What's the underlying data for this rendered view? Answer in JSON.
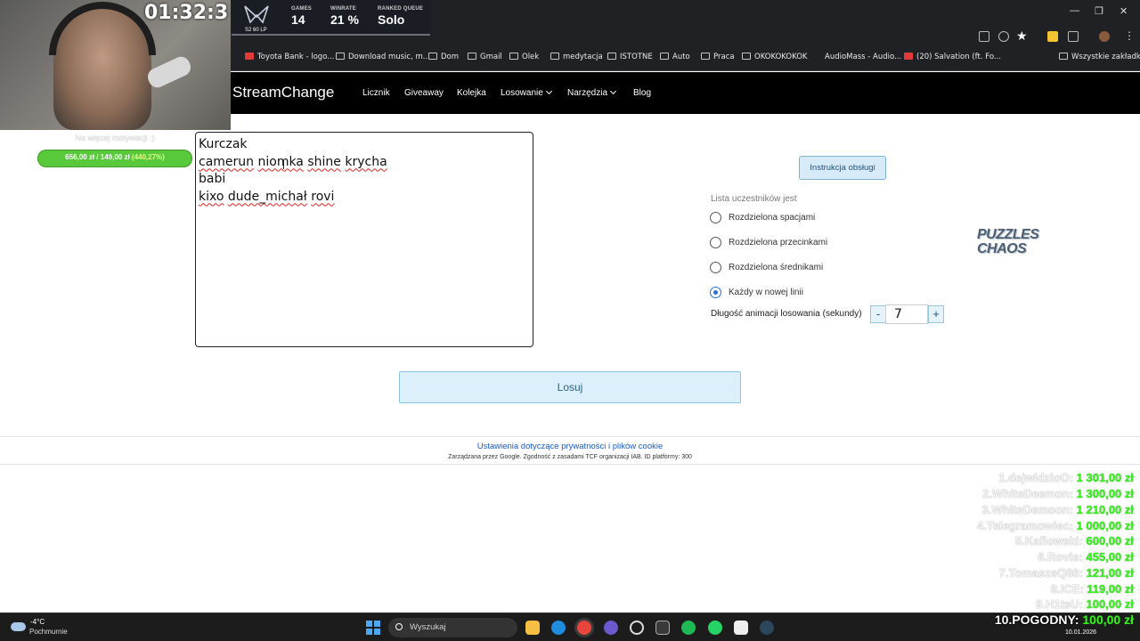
{
  "overlay": {
    "timer": "01:32:3",
    "stats": [
      {
        "label": "GAMES",
        "value": "14"
      },
      {
        "label": "WINRATE",
        "value": "21 %"
      },
      {
        "label": "RANKED QUEUE",
        "value": "Solo"
      }
    ],
    "lp": "S2 60 LP",
    "goal_label": "Na więcej motywacji :)",
    "goal_amount": "656,00 zł / 149,00 zł",
    "goal_pct": "(440,27%)"
  },
  "bookmarks": [
    {
      "label": "Toyota Bank - logo..."
    },
    {
      "label": "Download music, m..."
    },
    {
      "label": "Dom"
    },
    {
      "label": "Gmail"
    },
    {
      "label": "Olek"
    },
    {
      "label": "medytacja"
    },
    {
      "label": "ISTOTNE"
    },
    {
      "label": "Auto"
    },
    {
      "label": "Praca"
    },
    {
      "label": "OKOKOKOKOK"
    },
    {
      "label": "AudioMass - Audio..."
    },
    {
      "label": "(20) Salvation (ft. Fo..."
    },
    {
      "label": "Wszystkie zakładki"
    }
  ],
  "site": {
    "logo": "StreamChange",
    "nav": [
      {
        "label": "Licznik"
      },
      {
        "label": "Giveaway"
      },
      {
        "label": "Kolejka"
      },
      {
        "label": "Losowanie"
      },
      {
        "label": "Narzędzia"
      },
      {
        "label": "Blog"
      }
    ]
  },
  "participants": [
    "Kurczak",
    "camerun",
    "niomka",
    "shine",
    "krycha",
    "babi",
    "kixo",
    "dude_michał",
    "rovi"
  ],
  "options": {
    "instruction_button": "Instrukcja obsługi",
    "list_label": "Lista uczestników jest",
    "radios": [
      {
        "label": "Rozdzielona spacjami",
        "checked": false
      },
      {
        "label": "Rozdzielona przecinkami",
        "checked": false
      },
      {
        "label": "Rozdzielona średnikami",
        "checked": false
      },
      {
        "label": "Każdy w nowej linii",
        "checked": true
      }
    ],
    "duration_label": "Długość animacji losowania (sekundy)",
    "duration_minus": "-",
    "duration_value": "7",
    "duration_plus": "+",
    "partner_logo": "PUZZLES CHAOS"
  },
  "draw_button": "Losuj",
  "footer": {
    "privacy_link": "Ustawienia dotyczące prywatności i plików cookie",
    "privacy_note": "Zarządzana przez Google. Zgodność z zasadami TCF organizacji IAB. ID platformy: 300"
  },
  "leaderboard": [
    {
      "name": "1.dejwidzioO:",
      "amount": "1 301,00 zł"
    },
    {
      "name": "2.WhiteDeemon:",
      "amount": "1 300,00 zł"
    },
    {
      "name": "3.WhiteDemoon:",
      "amount": "1 210,00 zł"
    },
    {
      "name": "4.Telegramowiec:",
      "amount": "1 000,00 zł"
    },
    {
      "name": "5.Kaflowski:",
      "amount": "600,00 zł"
    },
    {
      "name": "6.Rovis:",
      "amount": "455,00 zł"
    },
    {
      "name": "7.TomaszeQ86:",
      "amount": "121,00 zł"
    },
    {
      "name": "8.ICE:",
      "amount": "119,00 zł"
    },
    {
      "name": "9.H1tsU:",
      "amount": "100,00 zł"
    },
    {
      "name": "10.POGODNY:",
      "amount": "100,00 zł"
    }
  ],
  "taskbar": {
    "temperature": "-4°C",
    "condition": "Pochmurnie",
    "search_placeholder": "Wyszukaj",
    "date": "10.01.2026"
  },
  "colors": {
    "site_header": "#000000",
    "draw_button_bg": "#dcf0fb",
    "radio_accent": "#2a6fd6",
    "donation_green": "#38f21c"
  }
}
